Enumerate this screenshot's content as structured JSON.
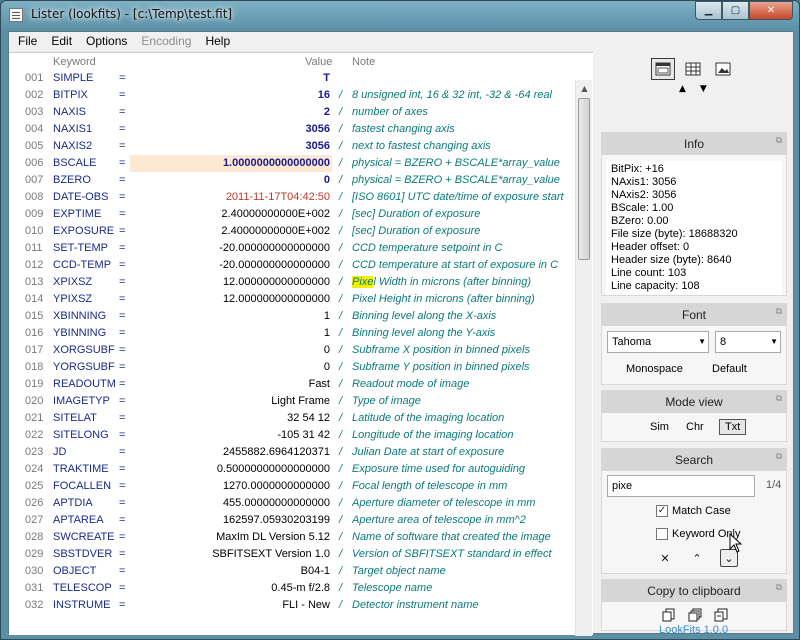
{
  "window": {
    "title": "Lister (lookfits) - [c:\\Temp\\test.fit]"
  },
  "menu": [
    "File",
    "Edit",
    "Options",
    "Encoding",
    "Help"
  ],
  "columns": {
    "keyword": "Keyword",
    "value": "Value",
    "note": "Note"
  },
  "rows": [
    {
      "n": "001",
      "k": "SIMPLE",
      "v": "T",
      "note": ""
    },
    {
      "n": "002",
      "k": "BITPIX",
      "v": "16",
      "note": "8 unsigned int, 16 & 32 int, -32 & -64 real"
    },
    {
      "n": "003",
      "k": "NAXIS",
      "v": "2",
      "note": "number of axes"
    },
    {
      "n": "004",
      "k": "NAXIS1",
      "v": "3056",
      "note": "fastest changing axis"
    },
    {
      "n": "005",
      "k": "NAXIS2",
      "v": "3056",
      "note": "next to fastest changing axis"
    },
    {
      "n": "006",
      "k": "BSCALE",
      "v": "1.0000000000000000",
      "note": "physical = BZERO + BSCALE*array_value"
    },
    {
      "n": "007",
      "k": "BZERO",
      "v": "0",
      "note": "physical = BZERO + BSCALE*array_value"
    },
    {
      "n": "008",
      "k": "DATE-OBS",
      "v": "2011-11-17T04:42:50",
      "note": "[ISO 8601] UTC date/time of exposure start"
    },
    {
      "n": "009",
      "k": "EXPTIME",
      "v": "2.40000000000E+002",
      "note": "[sec] Duration of exposure"
    },
    {
      "n": "010",
      "k": "EXPOSURE",
      "v": "2.40000000000E+002",
      "note": "[sec] Duration of exposure"
    },
    {
      "n": "011",
      "k": "SET-TEMP",
      "v": "-20.000000000000000",
      "note": "CCD temperature setpoint in C"
    },
    {
      "n": "012",
      "k": "CCD-TEMP",
      "v": "-20.000000000000000",
      "note": "CCD temperature at start of exposure in C"
    },
    {
      "n": "013",
      "k": "XPIXSZ",
      "v": "12.000000000000000",
      "note": "Pixel Width in microns (after binning)"
    },
    {
      "n": "014",
      "k": "YPIXSZ",
      "v": "12.000000000000000",
      "note": "Pixel Height in microns (after binning)"
    },
    {
      "n": "015",
      "k": "XBINNING",
      "v": "1",
      "note": "Binning level along the X-axis"
    },
    {
      "n": "016",
      "k": "YBINNING",
      "v": "1",
      "note": "Binning level along the Y-axis"
    },
    {
      "n": "017",
      "k": "XORGSUBF",
      "v": "0",
      "note": "Subframe X position in binned pixels"
    },
    {
      "n": "018",
      "k": "YORGSUBF",
      "v": "0",
      "note": "Subframe Y position in binned pixels"
    },
    {
      "n": "019",
      "k": "READOUTM",
      "v": "Fast",
      "note": "Readout mode of image"
    },
    {
      "n": "020",
      "k": "IMAGETYP",
      "v": "Light Frame",
      "note": "Type of image"
    },
    {
      "n": "021",
      "k": "SITELAT",
      "v": "32 54 12",
      "note": "Latitude of the imaging location"
    },
    {
      "n": "022",
      "k": "SITELONG",
      "v": "-105 31 42",
      "note": "Longitude of the imaging location"
    },
    {
      "n": "023",
      "k": "JD",
      "v": "2455882.6964120371",
      "note": "Julian Date at start of exposure"
    },
    {
      "n": "024",
      "k": "TRAKTIME",
      "v": "0.50000000000000000",
      "note": "Exposure time used for autoguiding"
    },
    {
      "n": "025",
      "k": "FOCALLEN",
      "v": "1270.0000000000000",
      "note": "Focal length of telescope in mm"
    },
    {
      "n": "026",
      "k": "APTDIA",
      "v": "455.00000000000000",
      "note": "Aperture diameter of telescope in mm"
    },
    {
      "n": "027",
      "k": "APTAREA",
      "v": "162597.05930203199",
      "note": "Aperture area of telescope in mm^2"
    },
    {
      "n": "028",
      "k": "SWCREATE",
      "v": "MaxIm DL Version 5.12",
      "note": "Name of software that created the image"
    },
    {
      "n": "029",
      "k": "SBSTDVER",
      "v": "SBFITSEXT Version 1.0",
      "note": "Version of SBFITSEXT standard in effect"
    },
    {
      "n": "030",
      "k": "OBJECT",
      "v": "B04-1",
      "note": "Target object name"
    },
    {
      "n": "031",
      "k": "TELESCOP",
      "v": "0.45-m f/2.8",
      "note": "Telescope name"
    },
    {
      "n": "032",
      "k": "INSTRUME",
      "v": "FLI - New",
      "note": "Detector instrument name"
    }
  ],
  "info": {
    "title": "Info",
    "lines": [
      "BitPix: +16",
      "NAxis1: 3056",
      "NAxis2: 3056",
      "BScale: 1.00",
      "BZero: 0.00",
      "File size (byte): 18688320",
      "Header offset: 0",
      "Header size (byte): 8640",
      "Line count: 103",
      "Line capacity: 108"
    ]
  },
  "font": {
    "title": "Font",
    "family": "Tahoma",
    "size": "8",
    "monospace": "Monospace",
    "default": "Default"
  },
  "mode": {
    "title": "Mode view",
    "sim": "Sim",
    "chr": "Chr",
    "txt": "Txt"
  },
  "search": {
    "title": "Search",
    "query": "pixe",
    "count": "1/4",
    "match_case": "Match Case",
    "keyword_only": "Keyword Only"
  },
  "clipboard": {
    "title": "Copy to clipboard"
  },
  "footer": {
    "version": "LookFits 1.0.0"
  },
  "colors": {
    "keyword": "#1a2a8a",
    "note": "#0b7a7a",
    "date": "#c0392b",
    "highlight_row": "#fde8d4",
    "search_mark": "#f3f000",
    "link": "#3a8fd0"
  }
}
